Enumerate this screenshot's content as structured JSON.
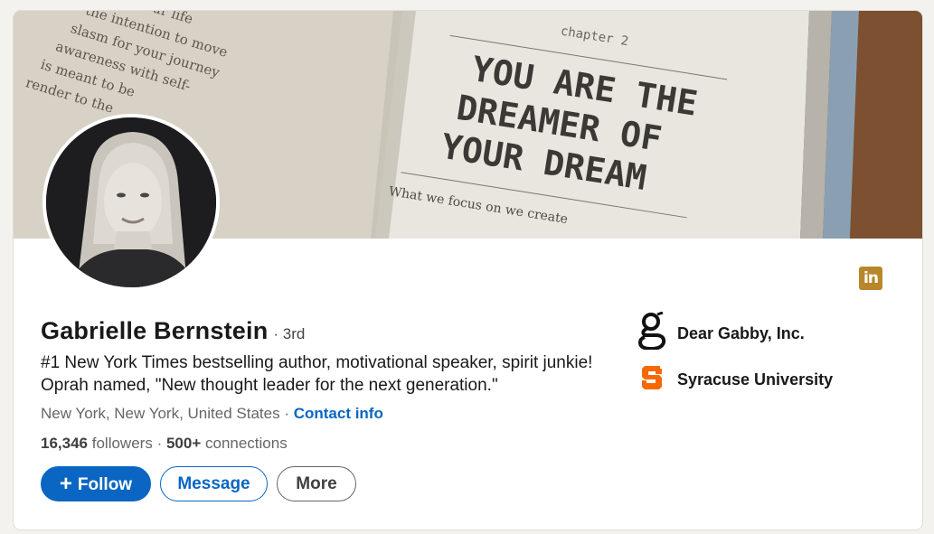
{
  "profile": {
    "name": "Gabrielle Bernstein",
    "degree": "· 3rd",
    "headline": "#1 New York Times bestselling author, motivational speaker, spirit junkie! Oprah named, \"New thought leader for the next generation.\"",
    "location": "New York, New York, United States",
    "location_sep": " · ",
    "contact_label": "Contact info",
    "followers_count": "16,346",
    "followers_label": "followers",
    "stats_sep": " · ",
    "connections_count": "500+",
    "connections_label": "connections"
  },
  "banner": {
    "chapter_label": "chapter 2",
    "heading_lines": [
      "YOU ARE THE",
      "DREAMER OF",
      "YOUR DREAM"
    ],
    "left_page_lines": [
      "on in your life",
      "the intention to move",
      "slasm for your journey",
      "awareness with self-",
      "is meant to be",
      "render to the"
    ],
    "body_line": "What we focus on we create"
  },
  "badges": {
    "linkedin_icon_text": "in",
    "linkedin_color": "#b8862b"
  },
  "actions": {
    "follow_label": "Follow",
    "follow_icon": "+",
    "message_label": "Message",
    "more_label": "More"
  },
  "organizations": [
    {
      "label": "Dear Gabby, Inc.",
      "logo_glyph": "g"
    },
    {
      "label": "Syracuse University",
      "logo_glyph": "S",
      "logo_color": "#f76900"
    }
  ],
  "colors": {
    "primary": "#0a66c2",
    "text": "#191919",
    "muted": "#666666"
  }
}
